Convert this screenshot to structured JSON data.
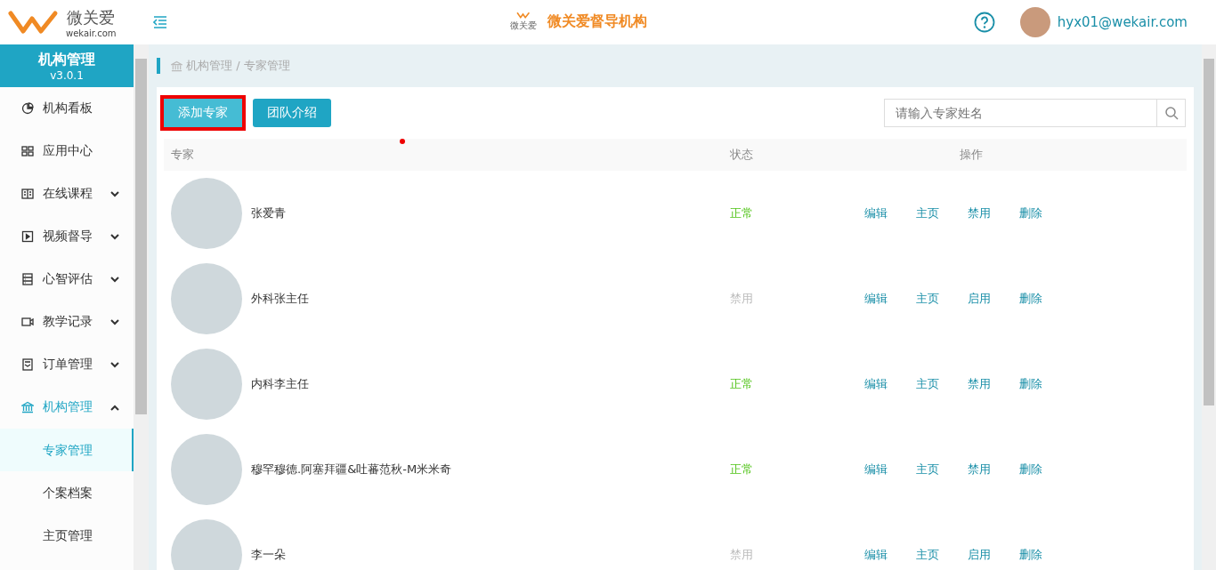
{
  "header": {
    "brand": "微关爱",
    "brand_domain": "wekair.com",
    "center_title": "微关爱督导机构",
    "center_logo_text": "微关爱",
    "user_email": "hyx01@wekair.com"
  },
  "sidebar": {
    "title": "机构管理",
    "version": "v3.0.1",
    "items": [
      {
        "label": "机构看板",
        "kind": "link",
        "selected": false
      },
      {
        "label": "应用中心",
        "kind": "link",
        "selected": false
      },
      {
        "label": "在线课程",
        "kind": "group",
        "expanded": false,
        "selected": false
      },
      {
        "label": "视频督导",
        "kind": "group",
        "expanded": false,
        "selected": false
      },
      {
        "label": "心智评估",
        "kind": "group",
        "expanded": false,
        "selected": false
      },
      {
        "label": "教学记录",
        "kind": "group",
        "expanded": false,
        "selected": false
      },
      {
        "label": "订单管理",
        "kind": "group",
        "expanded": false,
        "selected": false
      },
      {
        "label": "机构管理",
        "kind": "group",
        "expanded": true,
        "selected": true,
        "children": [
          {
            "label": "专家管理",
            "selected": true
          },
          {
            "label": "个案档案",
            "selected": false
          },
          {
            "label": "主页管理",
            "selected": false
          }
        ]
      }
    ]
  },
  "breadcrumb": "机构管理 / 专家管理",
  "toolbar": {
    "buttons": [
      {
        "label": "添加专家",
        "highlighted": true
      },
      {
        "label": "团队介绍",
        "highlighted": false
      }
    ],
    "search": {
      "placeholder": "请输入专家姓名"
    }
  },
  "table": {
    "columns": [
      "专家",
      "状态",
      "操作"
    ],
    "rows": [
      {
        "name": "张爱青",
        "status": "正常",
        "enabled": true,
        "actions": [
          "编辑",
          "主页",
          "禁用",
          "删除"
        ]
      },
      {
        "name": "外科张主任",
        "status": "禁用",
        "enabled": false,
        "actions": [
          "编辑",
          "主页",
          "启用",
          "删除"
        ]
      },
      {
        "name": "内科李主任",
        "status": "正常",
        "enabled": true,
        "actions": [
          "编辑",
          "主页",
          "禁用",
          "删除"
        ]
      },
      {
        "name": "穆罕穆德.阿塞拜疆&吐蕃范秋-M米米奇",
        "status": "正常",
        "enabled": true,
        "actions": [
          "编辑",
          "主页",
          "禁用",
          "删除"
        ]
      },
      {
        "name": "李一朵",
        "status": "禁用",
        "enabled": false,
        "actions": [
          "编辑",
          "主页",
          "启用",
          "删除"
        ]
      }
    ]
  }
}
